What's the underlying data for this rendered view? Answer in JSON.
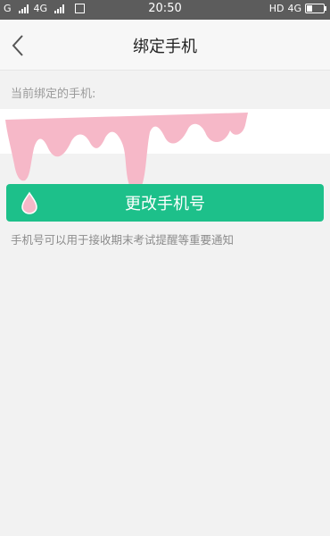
{
  "status_bar": {
    "carrier1": "G",
    "carrier2": "4G",
    "time": "20:50",
    "hd": "HD",
    "net": "4G"
  },
  "header": {
    "title": "绑定手机",
    "back_icon": "chevron-left-icon"
  },
  "bound_phone": {
    "label": "当前绑定的手机:",
    "value_masked": true
  },
  "actions": {
    "change_phone_label": "更改手机号"
  },
  "note": "手机号可以用于接收期末考试提醒等重要通知",
  "colors": {
    "accent": "#1dc08a",
    "mask_pink": "#f6b8c8",
    "status_bar": "#5c5c5c"
  }
}
